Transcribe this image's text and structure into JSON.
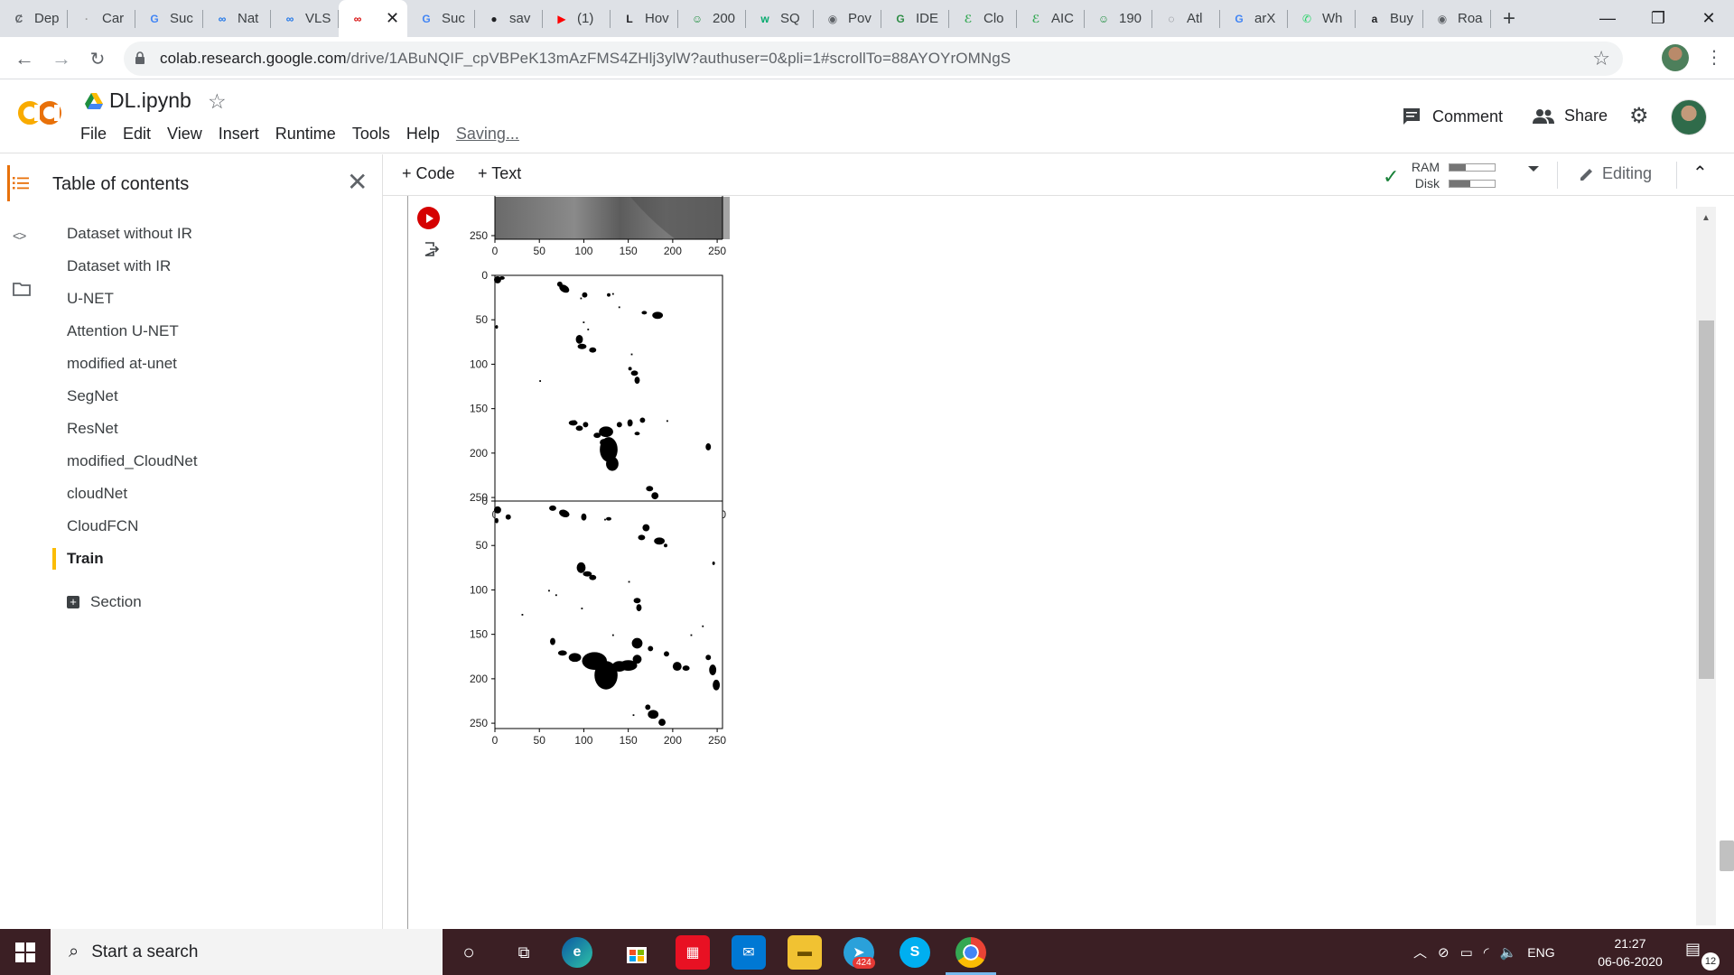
{
  "browser": {
    "tabs": [
      {
        "label": "Dep",
        "icon": "deepl-icon",
        "color": "#5f6368",
        "glyph": "Ȼ"
      },
      {
        "label": "Car",
        "icon": "car-site-icon",
        "color": "#9e9e9e",
        "glyph": "·"
      },
      {
        "label": "Suc",
        "icon": "google-icon",
        "color": "#4285f4",
        "glyph": "G"
      },
      {
        "label": "Nat",
        "icon": "colab-icon",
        "color": "#1a73e8",
        "glyph": "∞"
      },
      {
        "label": "VLS",
        "icon": "colab-icon",
        "color": "#1a73e8",
        "glyph": "∞"
      },
      {
        "label": "",
        "icon": "colab-icon",
        "color": "#d50000",
        "glyph": "∞",
        "active": true
      },
      {
        "label": "Suc",
        "icon": "google-icon",
        "color": "#4285f4",
        "glyph": "G"
      },
      {
        "label": "sav",
        "icon": "github-icon",
        "color": "#202124",
        "glyph": "●"
      },
      {
        "label": "(1)",
        "icon": "youtube-icon",
        "color": "#ff0000",
        "glyph": "▶"
      },
      {
        "label": "Hov",
        "icon": "latex-icon",
        "color": "#202124",
        "glyph": "L"
      },
      {
        "label": "200",
        "icon": "smiley-icon",
        "color": "#1e8e3e",
        "glyph": "☺"
      },
      {
        "label": "SQ",
        "icon": "w3schools-icon",
        "color": "#04aa6d",
        "glyph": "w"
      },
      {
        "label": "Pov",
        "icon": "globe-icon",
        "color": "#5f6368",
        "glyph": "◉"
      },
      {
        "label": "IDE",
        "icon": "geeksforgeeks-icon",
        "color": "#2f8d46",
        "glyph": "G"
      },
      {
        "label": "Clo",
        "icon": "leaf-icon",
        "color": "#34a853",
        "glyph": "ℰ"
      },
      {
        "label": "AIC",
        "icon": "leaf-icon",
        "color": "#34a853",
        "glyph": "ℰ"
      },
      {
        "label": "190",
        "icon": "smiley-icon",
        "color": "#1e8e3e",
        "glyph": "☺"
      },
      {
        "label": "Atl",
        "icon": "atlas-icon",
        "color": "#5f6368",
        "glyph": "◌"
      },
      {
        "label": "arX",
        "icon": "google-icon",
        "color": "#4285f4",
        "glyph": "G"
      },
      {
        "label": "Wh",
        "icon": "whatsapp-icon",
        "color": "#25d366",
        "glyph": "✆"
      },
      {
        "label": "Buy",
        "icon": "amazon-icon",
        "color": "#202124",
        "glyph": "a"
      },
      {
        "label": "Roa",
        "icon": "globe-icon",
        "color": "#5f6368",
        "glyph": "◉"
      }
    ],
    "tab_close": "✕",
    "new_tab": "+",
    "window_controls": {
      "minimize": "—",
      "maximize": "❐",
      "close": "✕"
    },
    "url_host": "colab.research.google.com",
    "url_path": "/drive/1ABuNQIF_cpVBPeK13mAzFMS4ZHlj3ylW?authuser=0&pli=1#scrollTo=88AYOYrOMNgS"
  },
  "colab": {
    "logo": "CO",
    "notebook_title": "DL.ipynb",
    "menu": [
      "File",
      "Edit",
      "View",
      "Insert",
      "Runtime",
      "Tools",
      "Help"
    ],
    "saving_status": "Saving...",
    "comment_label": "Comment",
    "share_label": "Share",
    "toolbar": {
      "code_label": "+ Code",
      "text_label": "+ Text",
      "ram_label": "RAM",
      "disk_label": "Disk",
      "ram_fraction": 0.35,
      "disk_fraction": 0.45,
      "editing_label": "Editing"
    }
  },
  "toc": {
    "title": "Table of contents",
    "items": [
      "Dataset without IR",
      "Dataset with IR",
      "U-NET",
      "Attention U-NET",
      "modified at-unet",
      "SegNet",
      "ResNet",
      "modified_CloudNet",
      "cloudNet",
      "CloudFCN",
      "Train"
    ],
    "active_item": "Train",
    "section_label": "Section"
  },
  "plots": {
    "x_ticks": [
      "0",
      "50",
      "100",
      "150",
      "200",
      "250"
    ],
    "y_ticks": [
      "0",
      "50",
      "100",
      "150",
      "200",
      "250"
    ],
    "partial_y_ticks": [
      "250"
    ],
    "images": [
      "grayscale satellite input (partially visible)",
      "predicted cloud mask",
      "ground truth cloud mask"
    ]
  },
  "taskbar": {
    "search_placeholder": "Start a search",
    "telegram_badge": "424",
    "language": "ENG",
    "time": "21:27",
    "date": "06-06-2020",
    "notifications": "12"
  }
}
